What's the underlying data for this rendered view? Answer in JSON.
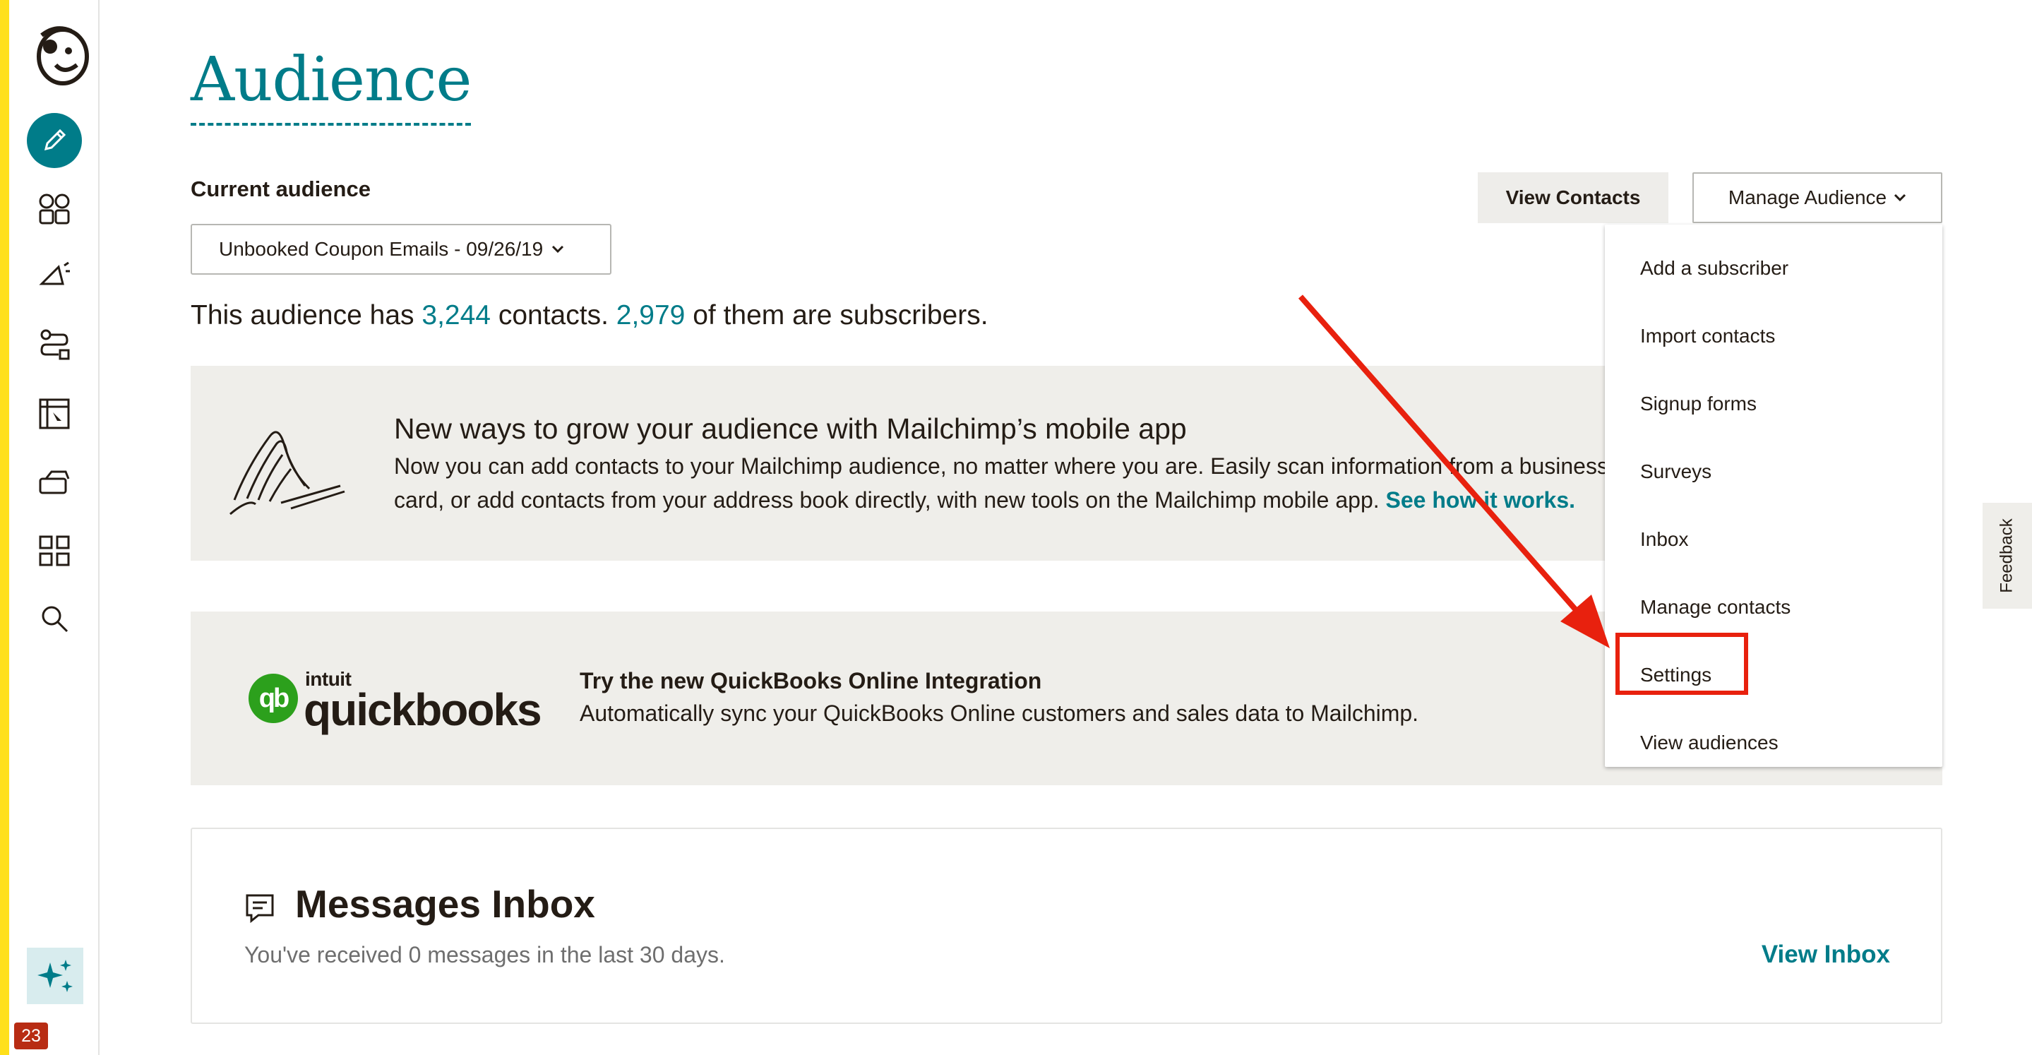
{
  "sidebar": {
    "items": [
      {
        "name": "create",
        "icon": "pencil-icon"
      },
      {
        "name": "audience",
        "icon": "audience-icon"
      },
      {
        "name": "campaigns",
        "icon": "megaphone-icon"
      },
      {
        "name": "automations",
        "icon": "automation-icon"
      },
      {
        "name": "website",
        "icon": "website-icon"
      },
      {
        "name": "content",
        "icon": "content-icon"
      },
      {
        "name": "integrations",
        "icon": "grid-icon"
      },
      {
        "name": "search",
        "icon": "search-icon"
      }
    ],
    "badge": "23",
    "accent_color": "#007c89",
    "brand_bar_color": "#ffe01b"
  },
  "header": {
    "title": "Audience"
  },
  "audience": {
    "label": "Current audience",
    "selected": "Unbooked Coupon Emails - 09/26/19",
    "summary_prefix": "This audience has",
    "contacts_count": "3,244",
    "summary_middle": "contacts.",
    "subscribers_count": "2,979",
    "summary_suffix": "of them are subscribers."
  },
  "actions": {
    "view_contacts": "View Contacts",
    "manage_audience": "Manage Audience"
  },
  "manage_menu": {
    "items": [
      "Add a subscriber",
      "Import contacts",
      "Signup forms",
      "Surveys",
      "Inbox",
      "Manage contacts",
      "Settings",
      "View audiences"
    ],
    "highlighted": "Settings",
    "highlight_color": "#e8210e"
  },
  "mobile_banner": {
    "title": "New ways to grow your audience with Mailchimp’s mobile app",
    "body": "Now you can add contacts to your Mailchimp audience, no matter where you are. Easily scan information from a business card, or add contacts from your address book directly, with new tools on the Mailchimp mobile app.",
    "link": "See how it works."
  },
  "quickbooks_banner": {
    "logo_brand": "intuit",
    "logo_name": "quickbooks",
    "title": "Try the new QuickBooks Online Integration",
    "body": "Automatically sync your QuickBooks Online customers and sales data to Mailchimp."
  },
  "inbox": {
    "title": "Messages Inbox",
    "body": "You've received 0 messages in the last 30 days.",
    "link": "View Inbox"
  },
  "feedback": {
    "label": "Feedback"
  }
}
